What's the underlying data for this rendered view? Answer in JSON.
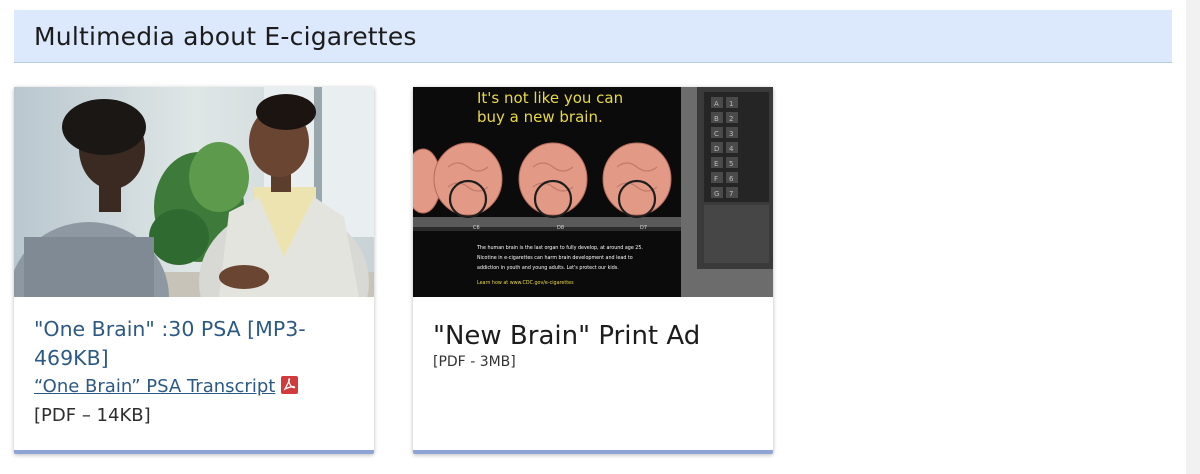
{
  "section": {
    "title": "Multimedia about E-cigarettes"
  },
  "cards": [
    {
      "title": "\"One Brain\" :30 PSA [MP3-469KB]",
      "transcript_link": "“One Brain” PSA Transcript",
      "transcript_icon": "pdf-icon",
      "transcript_meta": "[PDF – 14KB]",
      "image": "photo-woman-talking-with-teen"
    },
    {
      "title": "\"New Brain\" Print Ad",
      "meta": "[PDF - 3MB]",
      "image": {
        "headline_line1": "It's not like you can",
        "headline_line2": "buy a new brain.",
        "slot_labels": [
          "C6",
          "D8",
          "D7"
        ],
        "body_line1": "The human brain is the last organ to fully develop, at around age 25.",
        "body_line2": "Nicotine in e-cigarettes can harm brain development and lead to",
        "body_line3": "addiction in youth and young adults. Let's protect our kids.",
        "cta": "Learn how at www.CDC.gov/e-cigarettes",
        "keypad": [
          "A",
          "1",
          "B",
          "2",
          "C",
          "3",
          "D",
          "4",
          "E",
          "5",
          "F",
          "6",
          "G",
          "7"
        ]
      }
    }
  ],
  "colors": {
    "header_bg": "#dce8fc",
    "link": "#2d5985",
    "card_border_accent": "#8ea4d4",
    "ad_headline": "#e8d943"
  }
}
